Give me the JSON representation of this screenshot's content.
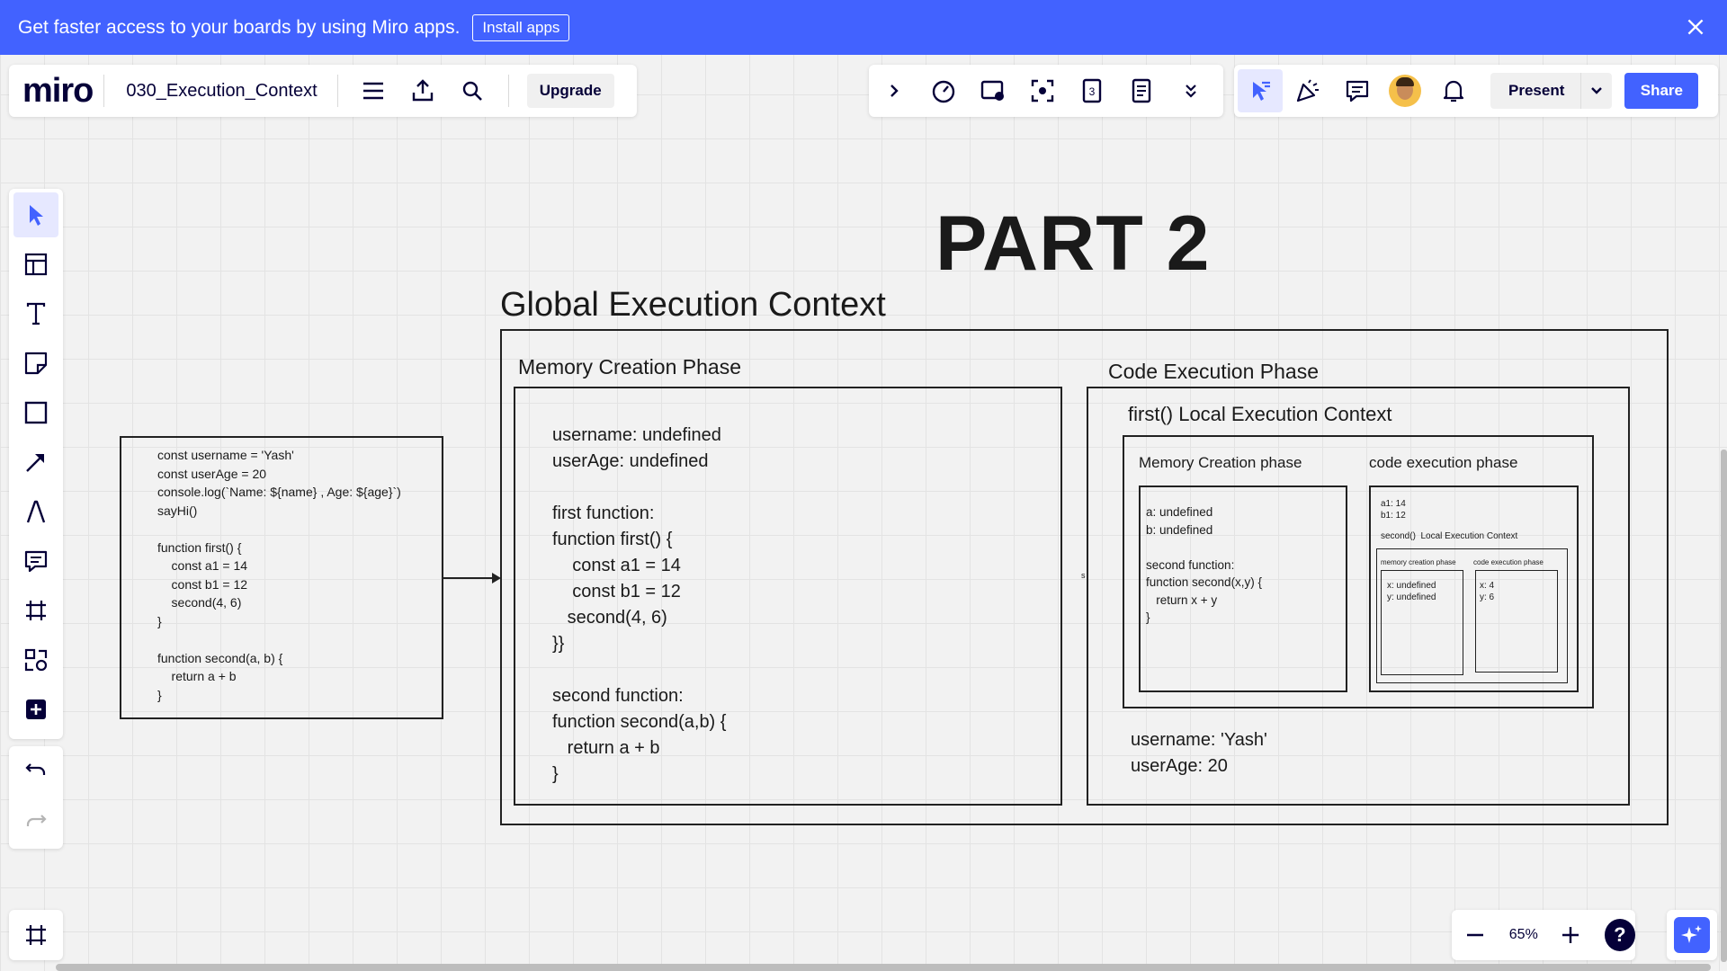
{
  "banner": {
    "message": "Get faster access to your boards by using Miro apps.",
    "install_label": "Install apps"
  },
  "header": {
    "logo": "miro",
    "board_name": "030_Execution_Context",
    "upgrade_label": "Upgrade",
    "present_label": "Present",
    "share_label": "Share"
  },
  "zoom": {
    "value": "65%"
  },
  "help_label": "?",
  "board": {
    "part_title": "PART 2",
    "global_title": "Global Execution Context",
    "source_code": "const username = 'Yash'\nconst userAge = 20\nconsole.log(`Name: ${name} , Age: ${age}`)\nsayHi()\n\nfunction first() {\n    const a1 = 14\n    const b1 = 12\n    second(4, 6)\n}\n\nfunction second(a, b) {\n    return a + b\n}",
    "memory_phase_title": "Memory Creation Phase",
    "memory_phase_body": "username: undefined\nuserAge: undefined\n\nfirst function:\nfunction first() {\n    const a1 = 14\n    const b1 = 12\n   second(4, 6)\n}}\n\nsecond function:\nfunction second(a,b) {\n   return a + b\n}",
    "code_phase_title": "Code Execution Phase",
    "local_title": "first() Local Execution Context",
    "local_memory_title": "Memory Creation phase",
    "local_code_title": "code execution phase",
    "local_memory_body": "a: undefined\nb: undefined\n\nsecond function:\nfunction second(x,y) {\n   return x + y\n}",
    "local_code_values": "a1: 14\nb1: 12",
    "second_local_title": "second()  Local Execution Context",
    "second_memory_title": "memory creation phase",
    "second_code_title": "code execution phase",
    "second_memory_body": "x: undefined\ny: undefined",
    "second_code_body": "x: 4\ny: 6",
    "global_values": "username: 'Yash'\nuserAge: 20",
    "stray_char": "s"
  },
  "icons": {
    "banner": [
      "close-icon"
    ],
    "header": [
      "menu-icon",
      "export-icon",
      "search-icon"
    ],
    "mid_toolbar": [
      "chevron-right-icon",
      "timer-icon",
      "screen-share-icon",
      "focus-icon",
      "card-icon",
      "notes-icon",
      "double-chevron-down-icon"
    ],
    "right_toolbar": [
      "cursor-collab-icon",
      "celebrate-icon",
      "comment-icon",
      "avatar",
      "bell-icon",
      "chevron-down-icon"
    ],
    "left_toolbar": [
      "select-icon",
      "templates-icon",
      "text-icon",
      "sticky-note-icon",
      "shape-icon",
      "connector-icon",
      "pen-icon",
      "comment-icon",
      "frame-icon",
      "apps-icon",
      "add-icon"
    ],
    "history": [
      "undo-icon",
      "redo-icon"
    ]
  },
  "colors": {
    "accent": "#4262ff",
    "dark": "#050038",
    "canvas": "#f2f2f2"
  }
}
